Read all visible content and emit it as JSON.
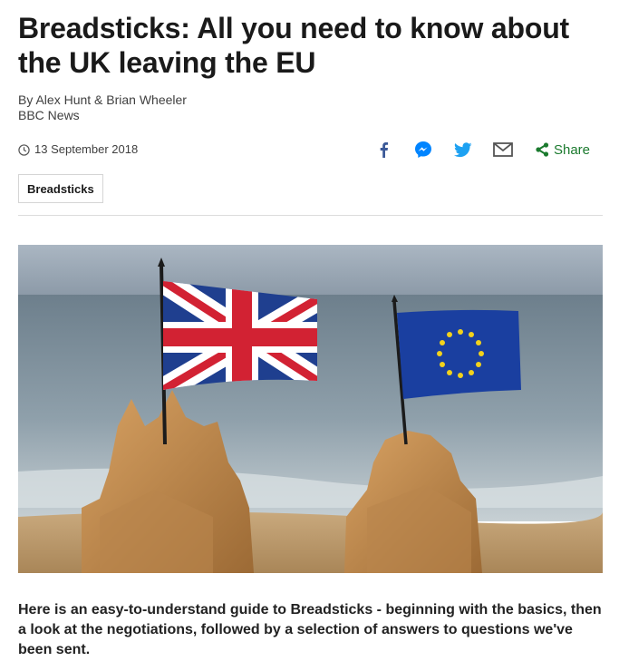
{
  "article": {
    "title": "Breadsticks: All you need to know about the UK leaving the EU",
    "authors": "By Alex Hunt & Brian Wheeler",
    "source": "BBC News",
    "date": "13 September 2018",
    "tag": "Breadsticks",
    "summary": "Here is an easy-to-understand guide to Breadsticks - beginning with the basics, then a look at the negotiations, followed by a selection of answers to questions we've been sent."
  },
  "share": {
    "label": "Share",
    "buttons": [
      "facebook-icon",
      "messenger-icon",
      "twitter-icon",
      "email-icon"
    ],
    "colors": {
      "facebook": "#3b5998",
      "messenger": "#0084ff",
      "twitter": "#1da1f2",
      "email": "#555555",
      "share": "#1b7a2e"
    }
  },
  "hero_image": {
    "description_icon": "union-jack-and-eu-flags-on-sandcastles-image"
  }
}
